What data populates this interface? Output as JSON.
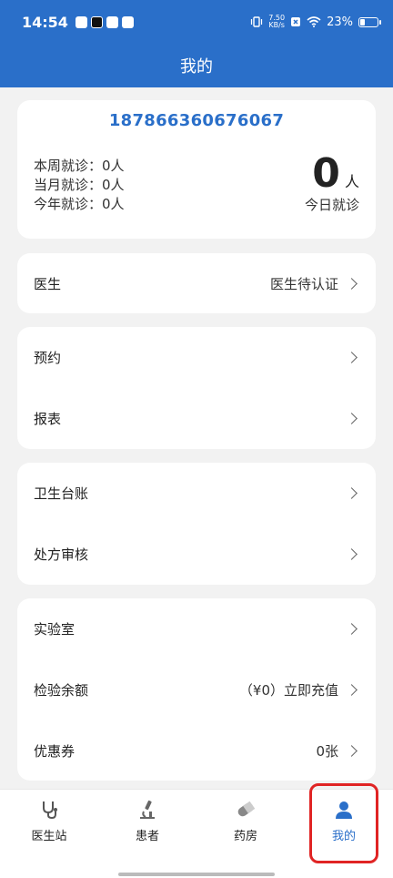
{
  "status_bar": {
    "time": "14:54",
    "speed_value": "7.50",
    "speed_unit": "KB/s",
    "battery": "23%",
    "battery_level": 0.23
  },
  "header": {
    "title": "我的"
  },
  "profile": {
    "phone": "187866360676067",
    "week_visits": "本周就诊：0人",
    "month_visits": "当月就诊：0人",
    "year_visits": "今年就诊：0人",
    "today_count": "0",
    "today_unit": "人",
    "today_label": "今日就诊"
  },
  "menu": {
    "doctor_label": "医生",
    "doctor_value": "医生待认证",
    "appointment_label": "预约",
    "report_label": "报表",
    "hygiene_label": "卫生台账",
    "prescription_label": "处方审核",
    "lab_label": "实验室",
    "balance_label": "检验余额",
    "balance_value": "（¥0）立即充值",
    "coupon_label": "优惠券",
    "coupon_value": "0张"
  },
  "nav": {
    "doctor_station": "医生站",
    "patients": "患者",
    "pharmacy": "药房",
    "mine": "我的"
  },
  "colors": {
    "primary": "#2a6fc9",
    "highlight": "#e02424"
  }
}
